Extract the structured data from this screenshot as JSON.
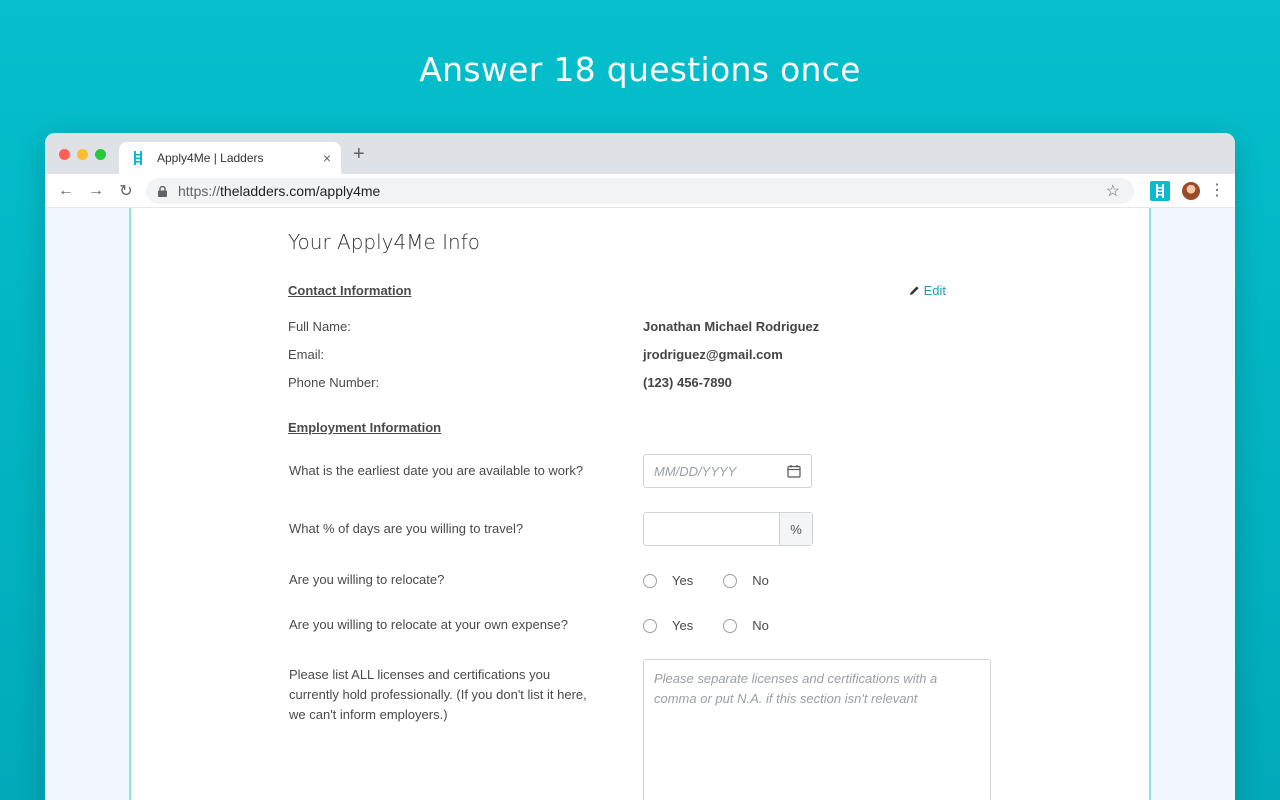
{
  "headline": "Answer 18 questions once",
  "browser": {
    "tab_title": "Apply4Me | Ladders",
    "tab_close": "×",
    "new_tab": "+",
    "url_scheme": "https://",
    "url_rest": "theladders.com/apply4me",
    "nav": {
      "back": "←",
      "forward": "→",
      "reload": "↻"
    },
    "star": "☆",
    "menu": "⋮"
  },
  "form": {
    "title": "Your Apply4Me Info",
    "contact": {
      "heading": "Contact Information",
      "edit_label": "Edit",
      "fields": [
        {
          "label": "Full Name:",
          "value": "Jonathan Michael Rodriguez"
        },
        {
          "label": "Email:",
          "value": "jrodriguez@gmail.com"
        },
        {
          "label": "Phone Number:",
          "value": "(123) 456-7890"
        }
      ]
    },
    "employment": {
      "heading": "Employment Information",
      "q_date": "What is the earliest date you are available to work?",
      "date_placeholder": "MM/DD/YYYY",
      "q_travel": "What % of days are you willing to travel?",
      "travel_suffix": "%",
      "q_relocate": "Are you willing to relocate?",
      "q_relocate_expense": "Are you willing to relocate at your own expense?",
      "yes": "Yes",
      "no": "No",
      "q_licenses_lines": [
        "Please list ALL licenses and certifications you",
        "currently hold professionally. (If you don't list it here,",
        "we can't inform employers.)"
      ],
      "licenses_placeholder_lines": [
        "Please separate licenses and certifications with a",
        "comma or put N.A. if this section isn't relevant"
      ]
    }
  },
  "colors": {
    "background": "#05bfcc",
    "accent": "#1aa0b0"
  }
}
